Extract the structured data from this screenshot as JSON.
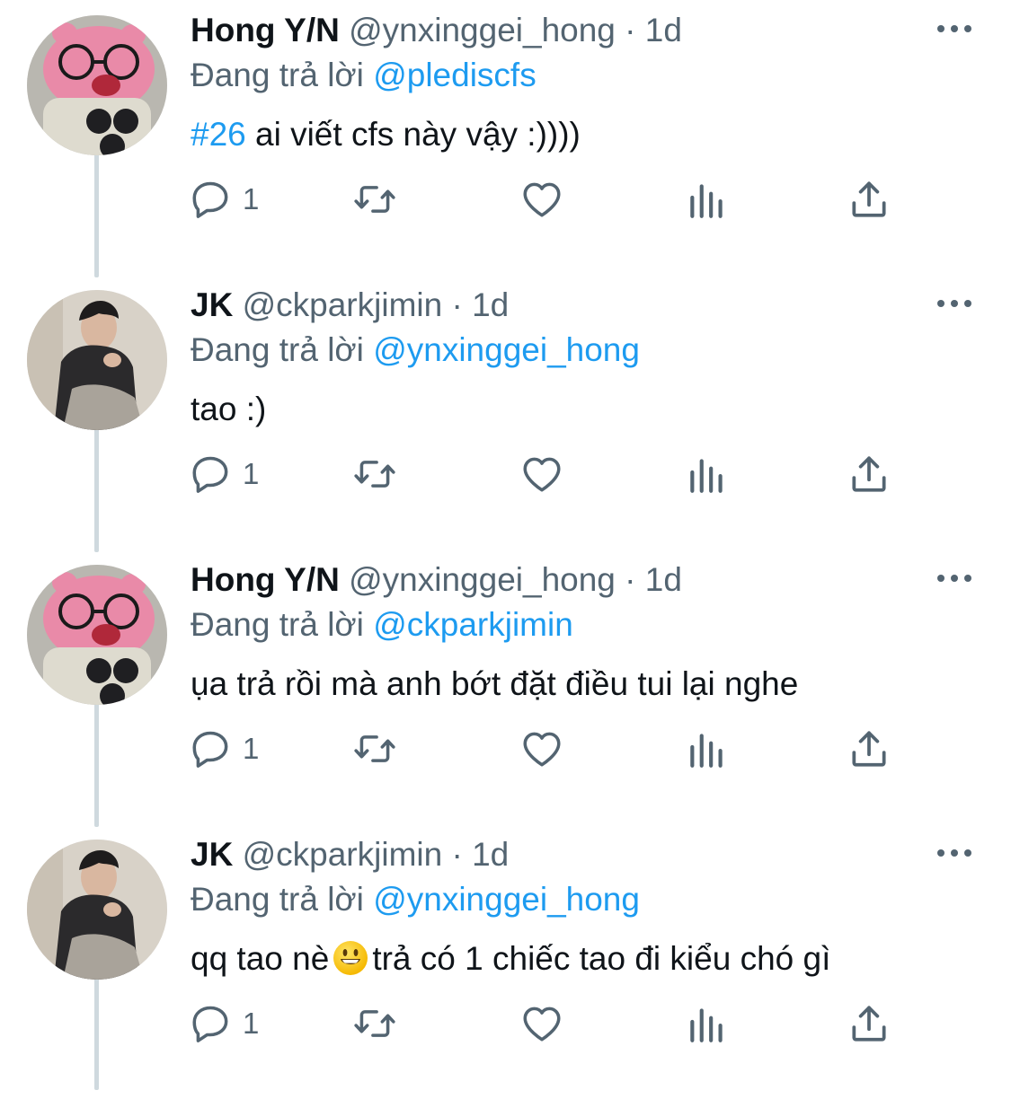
{
  "tweets": [
    {
      "name": "Hong Y/N",
      "handle": "@ynxinggei_hong",
      "dot": "·",
      "time": "1d",
      "reply_prefix": "Đang trả lời",
      "reply_to": "@plediscfs",
      "hashtag": "#26",
      "text": " ai viết cfs này vậy :))))",
      "text_after_emoji": "",
      "reply_count": "1",
      "avatar": "pink-plush-avatar"
    },
    {
      "name": "JK",
      "handle": "@ckparkjimin",
      "dot": "·",
      "time": "1d",
      "reply_prefix": "Đang trả lời",
      "reply_to": "@ynxinggei_hong",
      "hashtag": "",
      "text": "tao :)",
      "text_after_emoji": "",
      "reply_count": "1",
      "avatar": "man-portrait-avatar"
    },
    {
      "name": "Hong Y/N",
      "handle": "@ynxinggei_hong",
      "dot": "·",
      "time": "1d",
      "reply_prefix": "Đang trả lời",
      "reply_to": "@ckparkjimin",
      "hashtag": "",
      "text": "ụa trả rồi mà anh bớt đặt điều tui lại nghe",
      "text_after_emoji": "",
      "reply_count": "1",
      "avatar": "pink-plush-avatar"
    },
    {
      "name": "JK",
      "handle": "@ckparkjimin",
      "dot": "·",
      "time": "1d",
      "reply_prefix": "Đang trả lời",
      "reply_to": "@ynxinggei_hong",
      "hashtag": "",
      "text": "qq tao nè",
      "emoji": "grinning-face-emoji",
      "text_after_emoji": "trả có 1 chiếc tao đi kiểu chó gì",
      "reply_count": "1",
      "avatar": "man-portrait-avatar"
    }
  ],
  "colors": {
    "link": "#1d9bf0",
    "secondary": "#536471",
    "primary": "#0f1419",
    "thread_line": "#cfd9de"
  },
  "icons": [
    "reply-icon",
    "retweet-icon",
    "like-icon",
    "views-icon",
    "share-icon",
    "more-icon"
  ]
}
